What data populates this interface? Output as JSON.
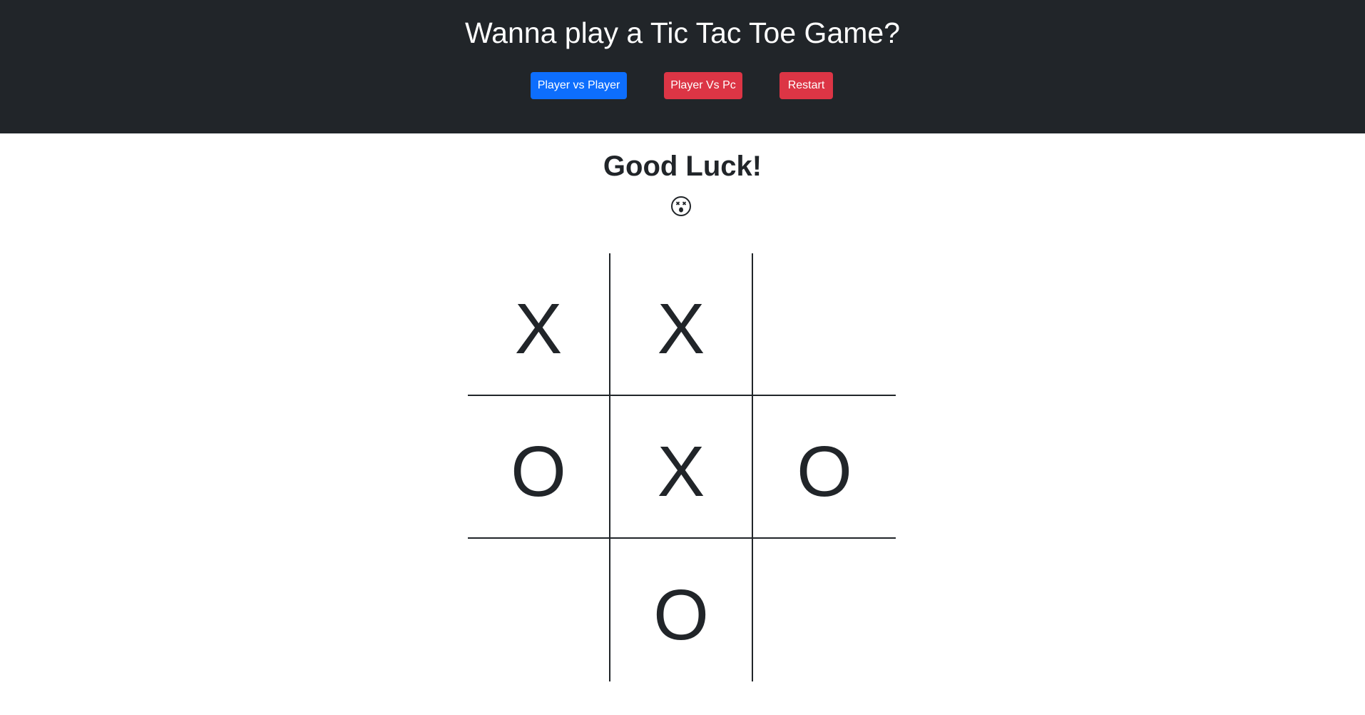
{
  "header": {
    "title": "Wanna play a Tic Tac Toe Game?",
    "buttons": {
      "player_vs_player": "Player vs Player",
      "player_vs_pc": "Player Vs Pc",
      "restart": "Restart"
    },
    "colors": {
      "background": "#212529",
      "primary": "#0d6efd",
      "danger": "#dc3545"
    }
  },
  "status": {
    "message": "Good Luck!",
    "icon": "dizzy-face-icon"
  },
  "board": {
    "cells": [
      "X",
      "X",
      "",
      "O",
      "X",
      "O",
      "",
      "O",
      ""
    ]
  }
}
